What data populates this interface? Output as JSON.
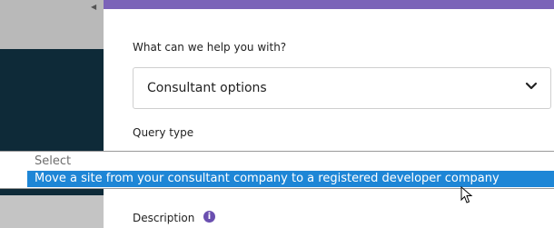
{
  "form": {
    "help_label": "What can we help you with?",
    "help_select_value": "Consultant options",
    "query_type_label": "Query type",
    "description_label": "Description"
  },
  "dropdown": {
    "placeholder_option": "Select",
    "highlighted_option": "Move a site from your consultant company to a registered developer company"
  },
  "icons": {
    "chevron": "chevron-down-icon",
    "info": "info-icon",
    "cursor": "mouse-cursor-icon"
  },
  "colors": {
    "accent_purple": "#7b63b8",
    "highlight_blue": "#1e86d6",
    "background_dark": "#0e2a38"
  }
}
